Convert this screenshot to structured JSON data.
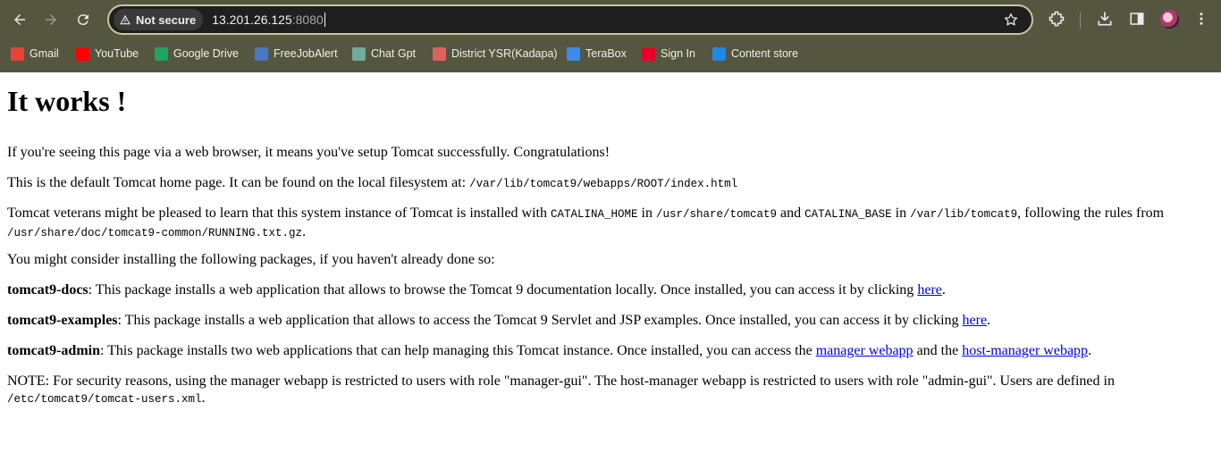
{
  "browser": {
    "security_label": "Not secure",
    "url_host": "13.201.26.125",
    "url_port": ":8080",
    "bookmarks": [
      {
        "label": "Gmail",
        "icon": "gmail-icon",
        "color": "#ea4335"
      },
      {
        "label": "YouTube",
        "icon": "youtube-icon",
        "color": "#ff0000"
      },
      {
        "label": "Google Drive",
        "icon": "google-drive-icon",
        "color": "#1fa463"
      },
      {
        "label": "FreeJobAlert",
        "icon": "freejobalert-icon",
        "color": "#4a76c4"
      },
      {
        "label": "Chat Gpt",
        "icon": "chatgpt-icon",
        "color": "#74aa9c"
      },
      {
        "label": "District YSR(Kadapa)",
        "icon": "district-icon",
        "color": "#e06060"
      },
      {
        "label": "TeraBox",
        "icon": "terabox-icon",
        "color": "#3b8beb"
      },
      {
        "label": "Sign In",
        "icon": "sign-in-icon",
        "color": "#e4002b"
      },
      {
        "label": "Content store",
        "icon": "content-store-icon",
        "color": "#1e88e5"
      }
    ]
  },
  "page": {
    "heading": "It works !",
    "p1": "If you're seeing this page via a web browser, it means you've setup Tomcat successfully. Congratulations!",
    "p2_text": "This is the default Tomcat home page. It can be found on the local filesystem at:",
    "p2_path": "/var/lib/tomcat9/webapps/ROOT/index.html",
    "p3_a": "Tomcat veterans might be pleased to learn that this system instance of Tomcat is installed with",
    "p3_home_var": "CATALINA_HOME",
    "p3_b": "in",
    "p3_home_path": "/usr/share/tomcat9",
    "p3_c": "and",
    "p3_base_var": "CATALINA_BASE",
    "p3_d": "in",
    "p3_base_path": "/var/lib/tomcat9",
    "p3_e": ", following the rules from",
    "p3_rules_path": "/usr/share/doc/tomcat9-common/RUNNING.txt.gz",
    "p3_end": ".",
    "p4": "You might consider installing the following packages, if you haven't already done so:",
    "docs_name": "tomcat9-docs",
    "docs_text": ": This package installs a web application that allows to browse the Tomcat 9 documentation locally. Once installed, you can access it by clicking",
    "docs_link": "here",
    "examples_name": "tomcat9-examples",
    "examples_text": ": This package installs a web application that allows to access the Tomcat 9 Servlet and JSP examples. Once installed, you can access it by clicking",
    "examples_link": "here",
    "admin_name": "tomcat9-admin",
    "admin_text": ": This package installs two web applications that can help managing this Tomcat instance. Once installed, you can access the",
    "admin_link1": "manager webapp",
    "admin_mid": "and the",
    "admin_link2": "host-manager webapp",
    "period": ".",
    "note_text": "NOTE: For security reasons, using the manager webapp is restricted to users with role \"manager-gui\". The host-manager webapp is restricted to users with role \"admin-gui\". Users are defined in",
    "note_path": "/etc/tomcat9/tomcat-users.xml"
  }
}
